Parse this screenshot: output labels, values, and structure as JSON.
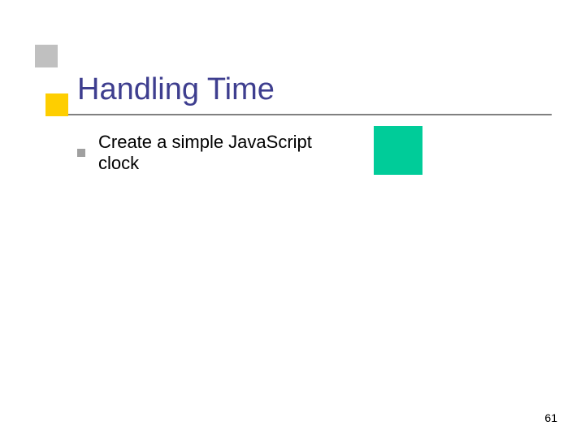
{
  "slide": {
    "title": "Handling Time",
    "bullets": [
      "Create a simple JavaScript clock"
    ],
    "page_number": "61"
  }
}
